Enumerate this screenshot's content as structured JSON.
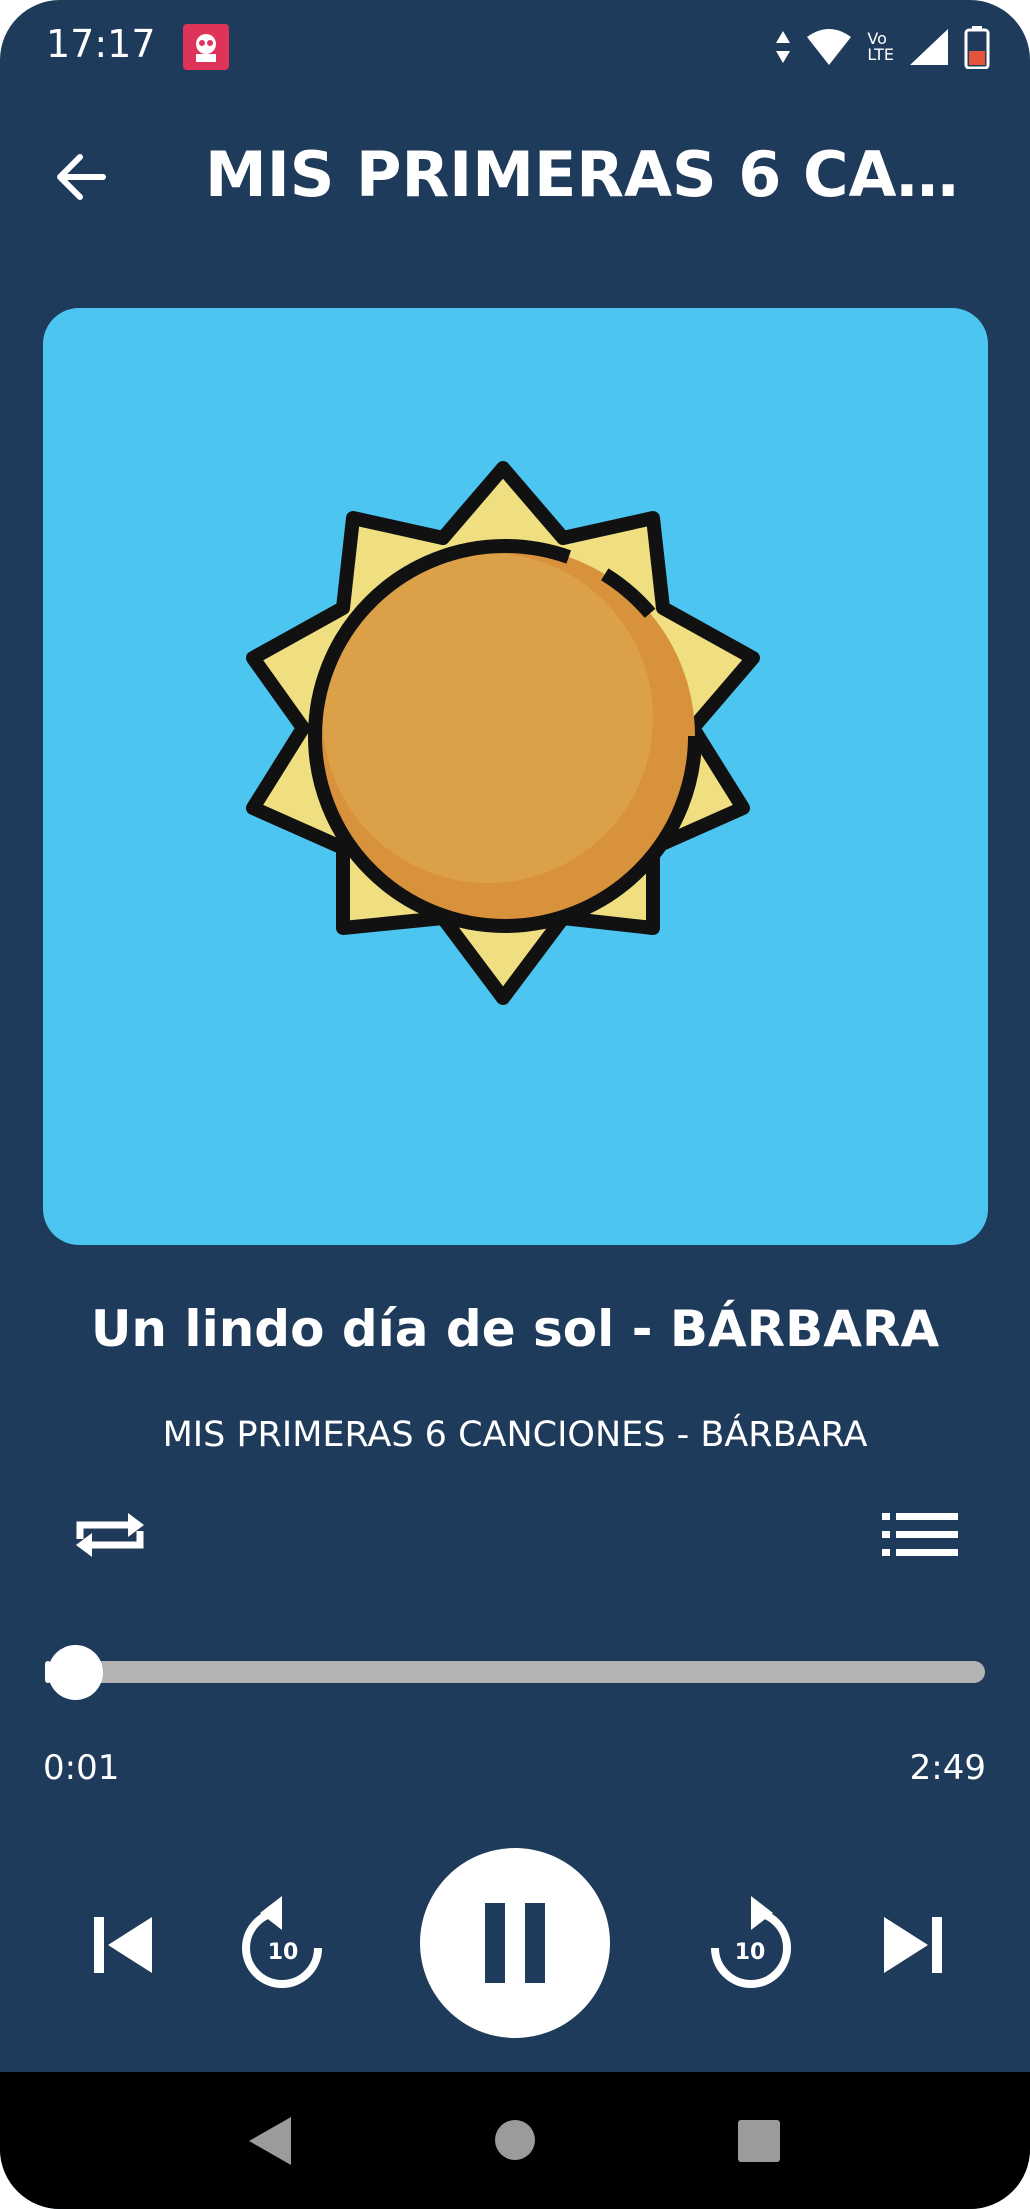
{
  "status_bar": {
    "time": "17:17",
    "icons": [
      "app-notification-icon",
      "data-arrows-icon",
      "wifi-icon",
      "volte-icon",
      "signal-icon",
      "battery-icon"
    ],
    "volte_label_top": "Vo",
    "volte_label_bottom": "LTE"
  },
  "header": {
    "title": "MIS PRIMERAS 6 CAN..."
  },
  "player": {
    "artwork_icon": "sun-icon",
    "song_title": "Un lindo día de sol - BÁRBARA",
    "album_line": "MIS PRIMERAS 6 CANCIONES - BÁRBARA",
    "elapsed": "0:01",
    "duration": "2:49",
    "progress_fraction": 0.006,
    "rewind_label": "10",
    "forward_label": "10"
  },
  "colors": {
    "background": "#1f3b5b",
    "artwork_bg": "#4cc6f0",
    "sun_rays": "#f0df80",
    "sun_core": "#e09a45",
    "track": "#b3b3b3"
  }
}
